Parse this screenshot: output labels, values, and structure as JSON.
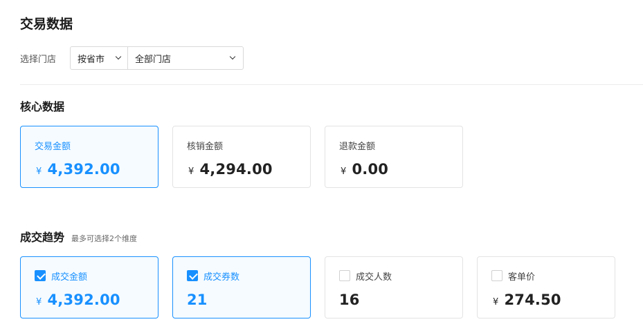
{
  "page": {
    "title": "交易数据"
  },
  "filter": {
    "label": "选择门店",
    "scope_select": "按省市",
    "store_select": "全部门店"
  },
  "core": {
    "title": "核心数据",
    "cards": [
      {
        "label": "交易金额",
        "currency": "¥",
        "value": "4,392.00",
        "active": true
      },
      {
        "label": "核销金额",
        "currency": "¥",
        "value": "4,294.00",
        "active": false
      },
      {
        "label": "退款金额",
        "currency": "¥",
        "value": "0.00",
        "active": false
      }
    ]
  },
  "trend": {
    "title": "成交趋势",
    "hint": "最多可选择2个维度",
    "cards": [
      {
        "label": "成交金额",
        "currency": "¥",
        "value": "4,392.00",
        "checked": true
      },
      {
        "label": "成交券数",
        "currency": "",
        "value": "21",
        "checked": true
      },
      {
        "label": "成交人数",
        "currency": "",
        "value": "16",
        "checked": false
      },
      {
        "label": "客单价",
        "currency": "¥",
        "value": "274.50",
        "checked": false
      }
    ]
  },
  "colors": {
    "accent": "#1890ff",
    "active_bg": "#f5fbff",
    "border": "#e3e3e3"
  }
}
